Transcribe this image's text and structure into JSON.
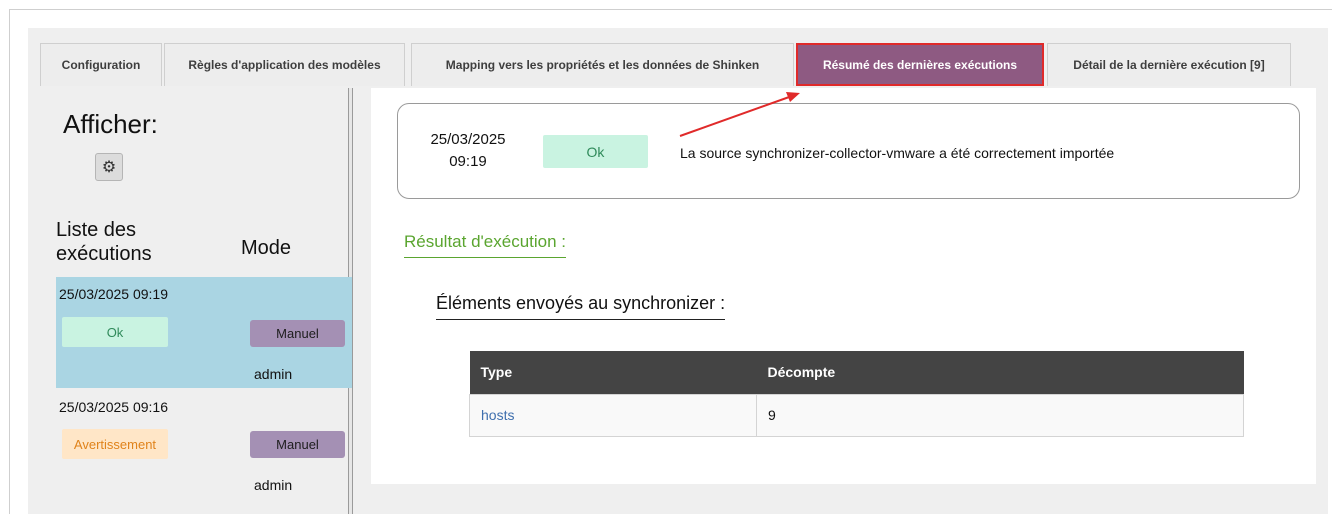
{
  "tabs": [
    {
      "label": "Configuration"
    },
    {
      "label": "Règles d'application des modèles"
    },
    {
      "label": "Mapping vers les propriétés et les données de Shinken"
    },
    {
      "label": "Résumé des dernières exécutions"
    },
    {
      "label": "Détail de la dernière exécution [9]"
    }
  ],
  "active_tab_index": 3,
  "left": {
    "afficher": "Afficher:",
    "gear_icon": "gear-icon",
    "col_list": "Liste des exécutions",
    "col_mode": "Mode",
    "executions": [
      {
        "date": "25/03/2025 09:19",
        "status": "Ok",
        "mode": "Manuel",
        "user": "admin",
        "selected": true
      },
      {
        "date": "25/03/2025 09:16",
        "status": "Avertissement",
        "mode": "Manuel",
        "user": "admin",
        "selected": false
      }
    ]
  },
  "summary": {
    "date_line1": "25/03/2025",
    "date_line2": "09:19",
    "status": "Ok",
    "message": "La source synchronizer-collector-vmware a été correctement importée"
  },
  "result_title": "Résultat d'exécution :",
  "sent_title": "Éléments envoyés au synchronizer :",
  "table": {
    "headers": [
      "Type",
      "Décompte"
    ],
    "rows": [
      [
        "hosts",
        "9"
      ]
    ]
  },
  "colors": {
    "active_tab": "#8e5a82",
    "highlight_border": "#e02a2a",
    "ok_bg": "#c9f3e1",
    "warn_bg": "#ffe6c7",
    "result_green": "#5aa52f"
  }
}
